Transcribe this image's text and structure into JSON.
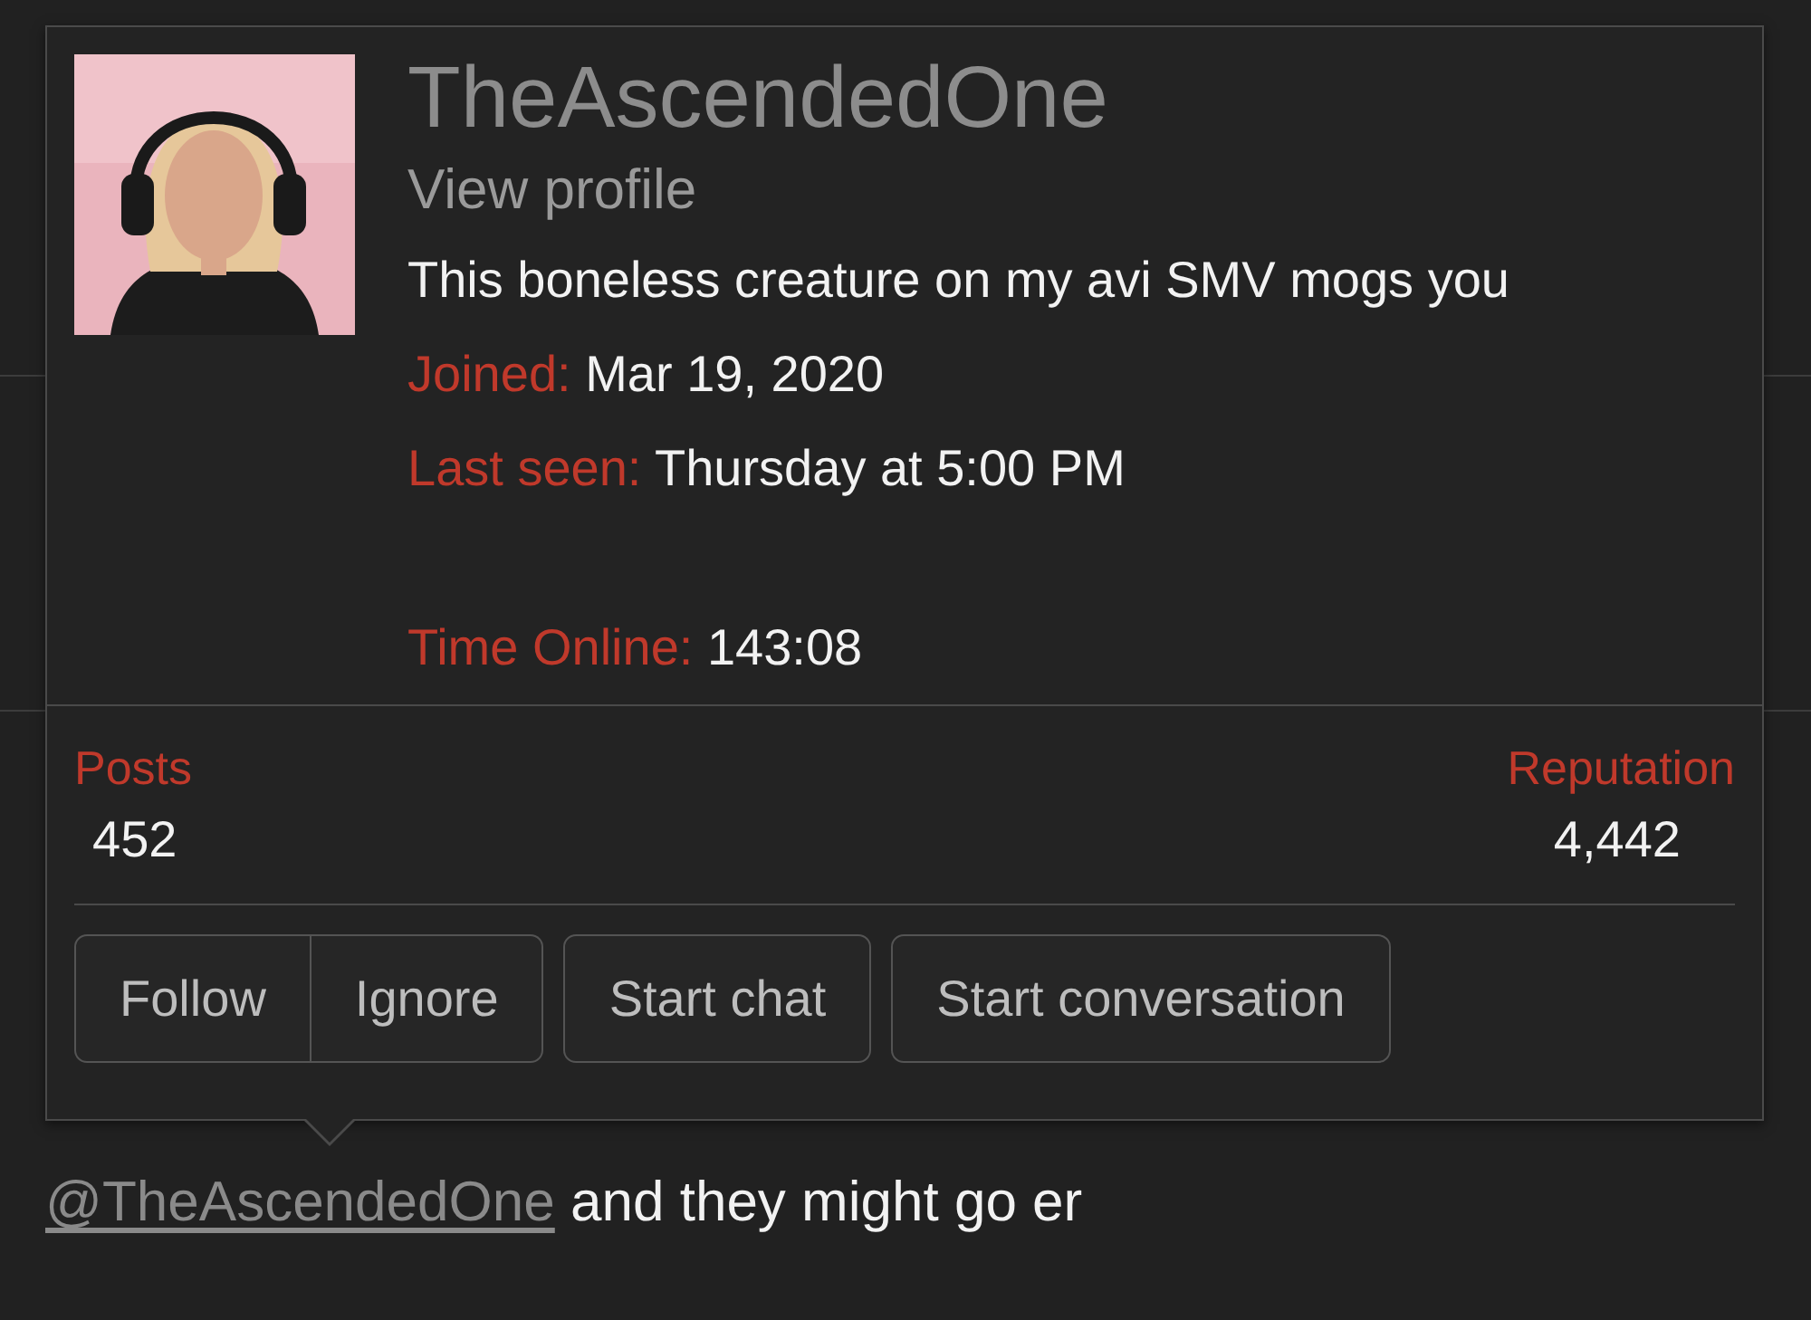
{
  "popup": {
    "username": "TheAscendedOne",
    "profile_link": "View profile",
    "bio": "This boneless creature on my avi SMV mogs you",
    "details": [
      {
        "label": "Joined:",
        "value": "Mar 19, 2020"
      },
      {
        "label": "Last seen:",
        "value": "Thursday at 5:00 PM"
      },
      {
        "label": "Time Online:",
        "value": "143:08"
      }
    ],
    "stats": [
      {
        "label": "Posts",
        "value": "452"
      },
      {
        "label": "Reputation",
        "value": "4,442"
      }
    ],
    "buttons": [
      {
        "label": "Follow",
        "kind": "group"
      },
      {
        "label": "Ignore",
        "kind": "group"
      },
      {
        "label": "Start chat",
        "kind": "single"
      },
      {
        "label": "Start conversation",
        "kind": "single"
      }
    ]
  },
  "post_text": {
    "mention": "@TheAscendedOne",
    "text": "and they might go er"
  }
}
